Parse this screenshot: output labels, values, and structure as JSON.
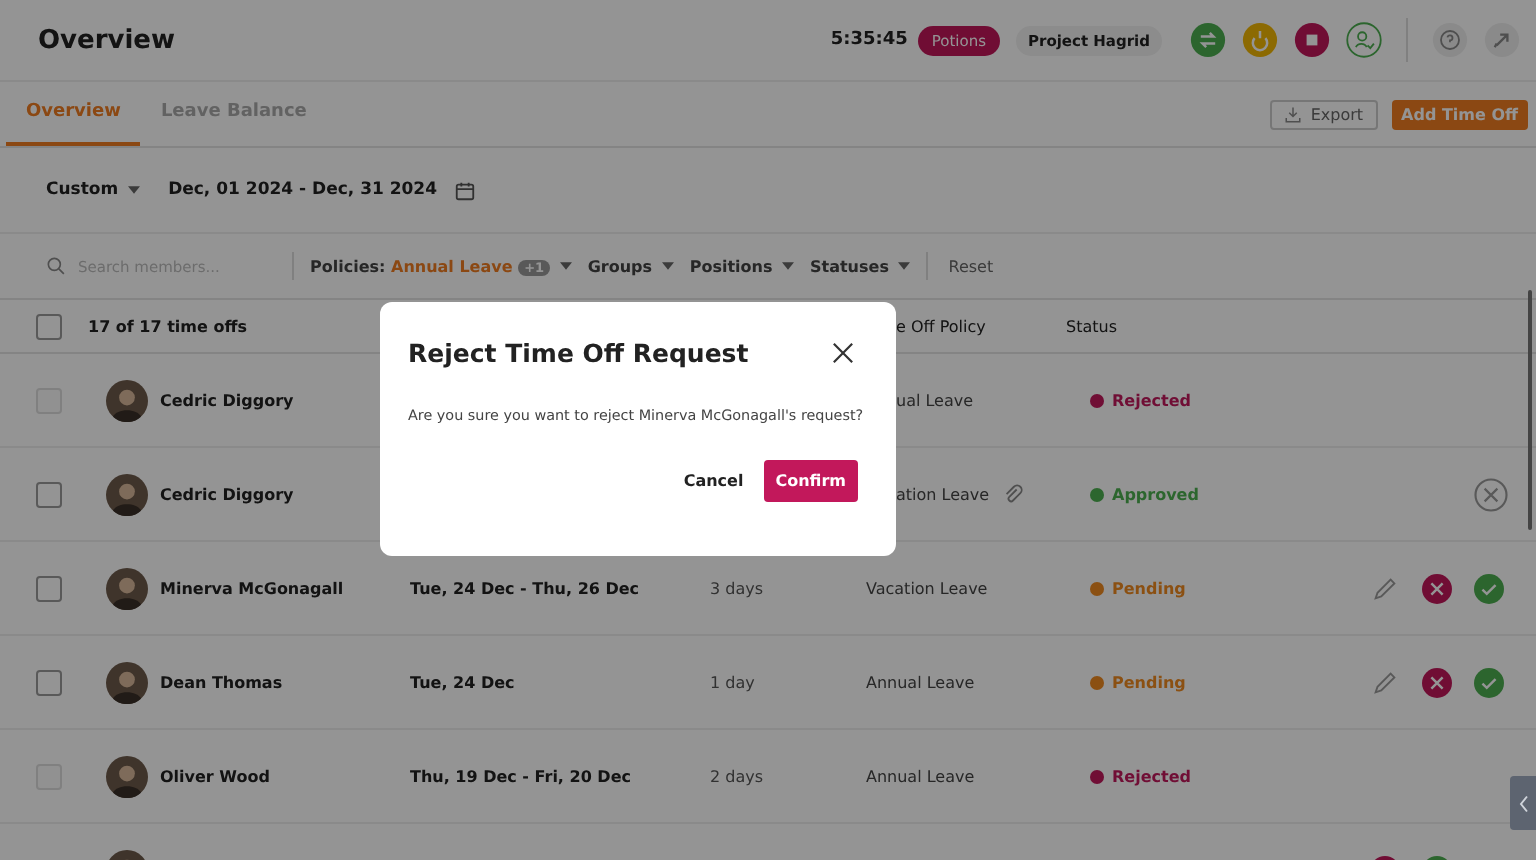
{
  "header": {
    "title": "Overview",
    "timer": "5:35:45",
    "project_tag": "Potions",
    "project": "Project Hagrid"
  },
  "tabs": [
    {
      "label": "Overview",
      "selected": true
    },
    {
      "label": "Leave Balance",
      "selected": false
    }
  ],
  "actions": {
    "export": "Export",
    "add": "Add Time Off"
  },
  "range": {
    "preset": "Custom",
    "dates": "Dec, 01 2024 - Dec, 31 2024"
  },
  "filters": {
    "placeholder": "Search members...",
    "policies_label": "Policies:",
    "policies_value": "Annual Leave",
    "policies_more": "+1",
    "groups": "Groups",
    "positions": "Positions",
    "statuses": "Statuses",
    "reset": "Reset"
  },
  "table": {
    "count": "17 of 17 time offs",
    "select_all": {
      "checked": false
    },
    "columns": [
      "e Off Policy",
      "Status"
    ],
    "rows": [
      {
        "name": "Cedric Diggory",
        "policy": "ual Leave",
        "covered": true,
        "status": "Rejected",
        "color": "#700e35",
        "disabled": true,
        "kind": "none"
      },
      {
        "name": "Cedric Diggory",
        "policy": "ation Leave",
        "covered": true,
        "attachment": true,
        "status": "Approved",
        "color": "#2c662e",
        "disabled": false,
        "kind": "cancel"
      },
      {
        "name": "Minerva McGonagall",
        "dates": "Tue, 24 Dec - Thu, 26 Dec",
        "days": "3 days",
        "policy": "Vacation Leave",
        "status": "Pending",
        "color": "#8b5012",
        "disabled": false,
        "kind": "review"
      },
      {
        "name": "Dean Thomas",
        "dates": "Tue, 24 Dec",
        "days": "1 day",
        "policy": "Annual Leave",
        "status": "Pending",
        "color": "#8b5012",
        "disabled": false,
        "kind": "review"
      },
      {
        "name": "Oliver Wood",
        "dates": "Thu, 19 Dec - Fri, 20 Dec",
        "days": "2 days",
        "policy": "Annual Leave",
        "status": "Rejected",
        "color": "#700e35",
        "disabled": true,
        "kind": "none"
      },
      {
        "kind": "decide"
      }
    ]
  },
  "dialog": {
    "title": "Reject Time Off Request",
    "message": "Are you sure you want to reject Minerva McGonagall's request?",
    "cancel": "Cancel",
    "confirm": "Confirm"
  }
}
